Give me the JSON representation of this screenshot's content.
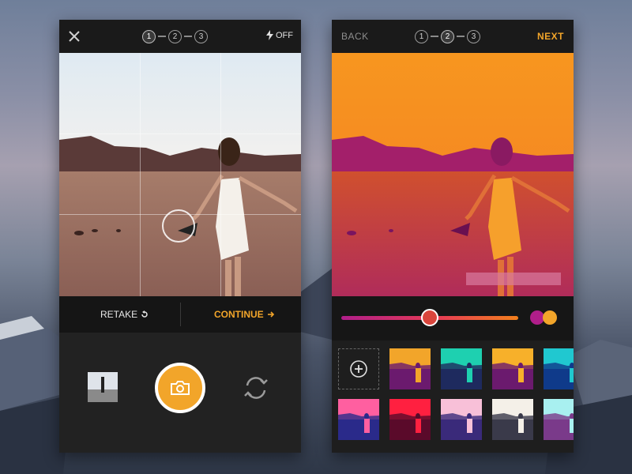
{
  "camera_screen": {
    "close_icon": "close-icon",
    "steps": [
      {
        "label": "1",
        "active": true
      },
      {
        "label": "2",
        "active": false
      },
      {
        "label": "3",
        "active": false
      }
    ],
    "flash_label": "OFF",
    "retake_label": "RETAKE",
    "continue_label": "CONTINUE"
  },
  "filter_screen": {
    "back_label": "BACK",
    "next_label": "NEXT",
    "steps": [
      {
        "label": "1",
        "active": false
      },
      {
        "label": "2",
        "active": true
      },
      {
        "label": "3",
        "active": false
      }
    ],
    "slider_value": 0.5,
    "duotone_colors": [
      "#b01e8a",
      "#f2a52a"
    ],
    "filters": [
      {
        "from": "#6b1a6e",
        "to": "#f2a52a"
      },
      {
        "from": "#1e2a5e",
        "to": "#1ed0b0"
      },
      {
        "from": "#6b1a6e",
        "to": "#f7b02a"
      },
      {
        "from": "#0f3a8a",
        "to": "#20c8d0"
      },
      {
        "from": "#2a2a8a",
        "to": "#ff5fa0"
      },
      {
        "from": "#5a0a2a",
        "to": "#ff2040"
      },
      {
        "from": "#3a2a7a",
        "to": "#f8c0d8"
      },
      {
        "from": "#3a3a4a",
        "to": "#f4f0e8"
      },
      {
        "from": "#7a3a8a",
        "to": "#a8f0f0"
      }
    ]
  },
  "colors": {
    "accent": "#f2a52a"
  }
}
